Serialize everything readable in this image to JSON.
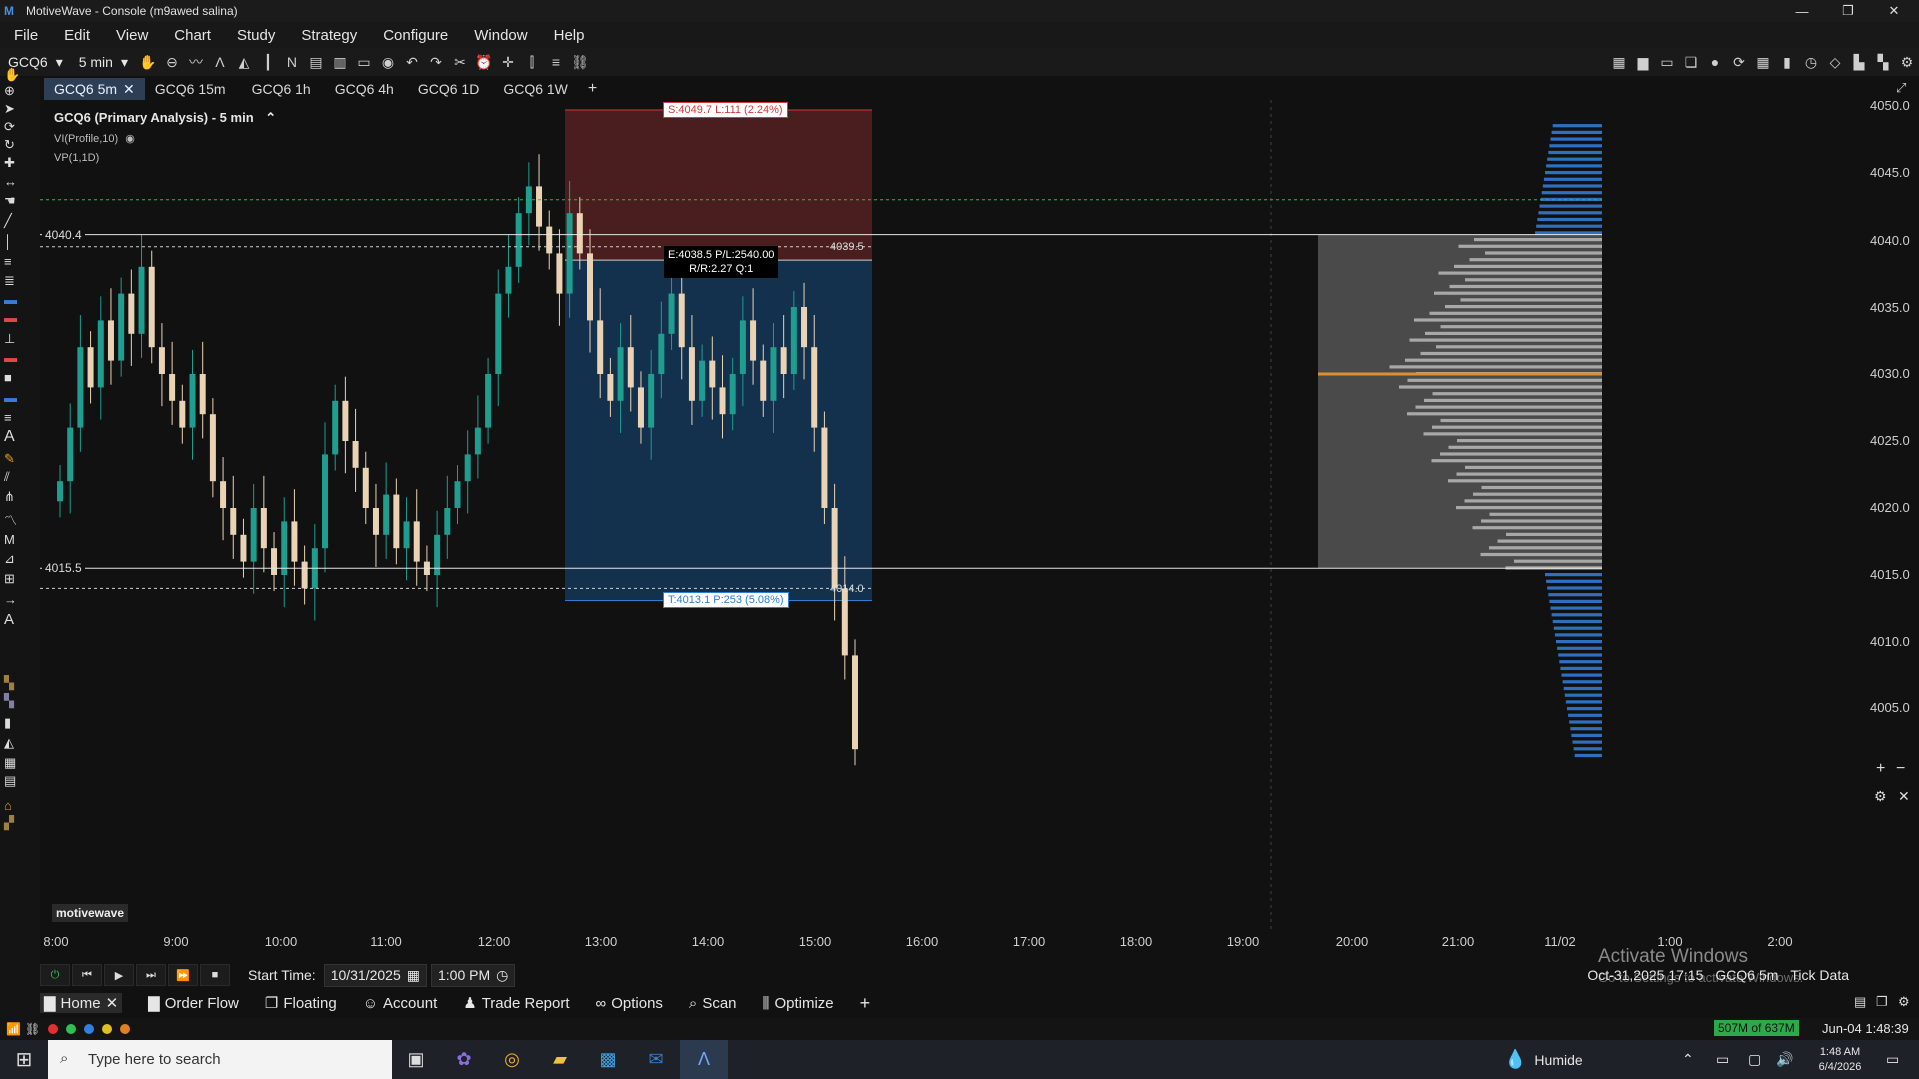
{
  "window": {
    "title": "MotiveWave - Console (m9awed salina)"
  },
  "menu": [
    "File",
    "Edit",
    "View",
    "Chart",
    "Study",
    "Strategy",
    "Configure",
    "Window",
    "Help"
  ],
  "toolbar": {
    "symbol": "GCQ6",
    "interval": "5 min"
  },
  "chart_tabs": [
    "GCQ6 5m",
    "GCQ6 15m",
    "GCQ6 1h",
    "GCQ6 4h",
    "GCQ6 1D",
    "GCQ6 1W"
  ],
  "chart": {
    "title": "GCQ6 (Primary Analysis) - 5 min",
    "studies": [
      "VI(Profile,10)",
      "VP(1,1D)"
    ],
    "brand": "motivewave",
    "level_upper": "4040.4",
    "level_lower": "4015.5",
    "stop_label": "S:4049.7 L:111 (2.24%)",
    "target_label": "T:4013.1 P:253 (5.08%)",
    "entry_label_1": "E:4038.5 P/L:2540.00",
    "entry_label_2": "R/R:2.27 Q:1",
    "entry_price": "4039.5",
    "target_price": "4014.0",
    "status_date": "Oct-31,2025 17:15",
    "status_symbol": "GCQ6 5m",
    "status_data": "Tick Data"
  },
  "chart_data": {
    "type": "candlestick",
    "x_tick_labels": [
      "8:00",
      "9:00",
      "10:00",
      "11:00",
      "12:00",
      "13:00",
      "14:00",
      "15:00",
      "16:00",
      "17:00",
      "18:00",
      "19:00",
      "20:00",
      "21:00",
      "11/02",
      "1:00",
      "2:00"
    ],
    "y_tick_labels": [
      "4050.0",
      "4045.0",
      "4040.0",
      "4035.0",
      "4030.0",
      "4025.0",
      "4020.0",
      "4015.0",
      "4010.0",
      "4005.0"
    ],
    "ylim": [
      4001.5,
      4051.5
    ],
    "levels": {
      "upper": 4040.4,
      "lower": 4015.5,
      "dashed_upper": 4039.5,
      "dashed_lower": 4014.0,
      "poc": 4030.0,
      "green_dashed": 4043.0
    },
    "trade": {
      "entry": 4038.5,
      "stop": 4049.7,
      "target": 4013.1
    },
    "up_color": "#1f9d8f",
    "down_color": "#e9d3b4"
  },
  "playback": {
    "start_label": "Start Time:",
    "date": "10/31/2025",
    "time": "1:00 PM"
  },
  "bottom_tabs": [
    "Home",
    "Order Flow",
    "Floating",
    "Account",
    "Trade Report",
    "Options",
    "Scan",
    "Optimize"
  ],
  "status": {
    "memory": "507M of 637M",
    "datetime": "Jun-04 1:48:39"
  },
  "watermark": {
    "line1": "Activate Windows",
    "line2": "Go to Settings to activate Windows."
  },
  "taskbar": {
    "search_placeholder": "Type here to search",
    "weather": "Humide",
    "time": "1:48 AM",
    "date": "6/4/2026"
  }
}
